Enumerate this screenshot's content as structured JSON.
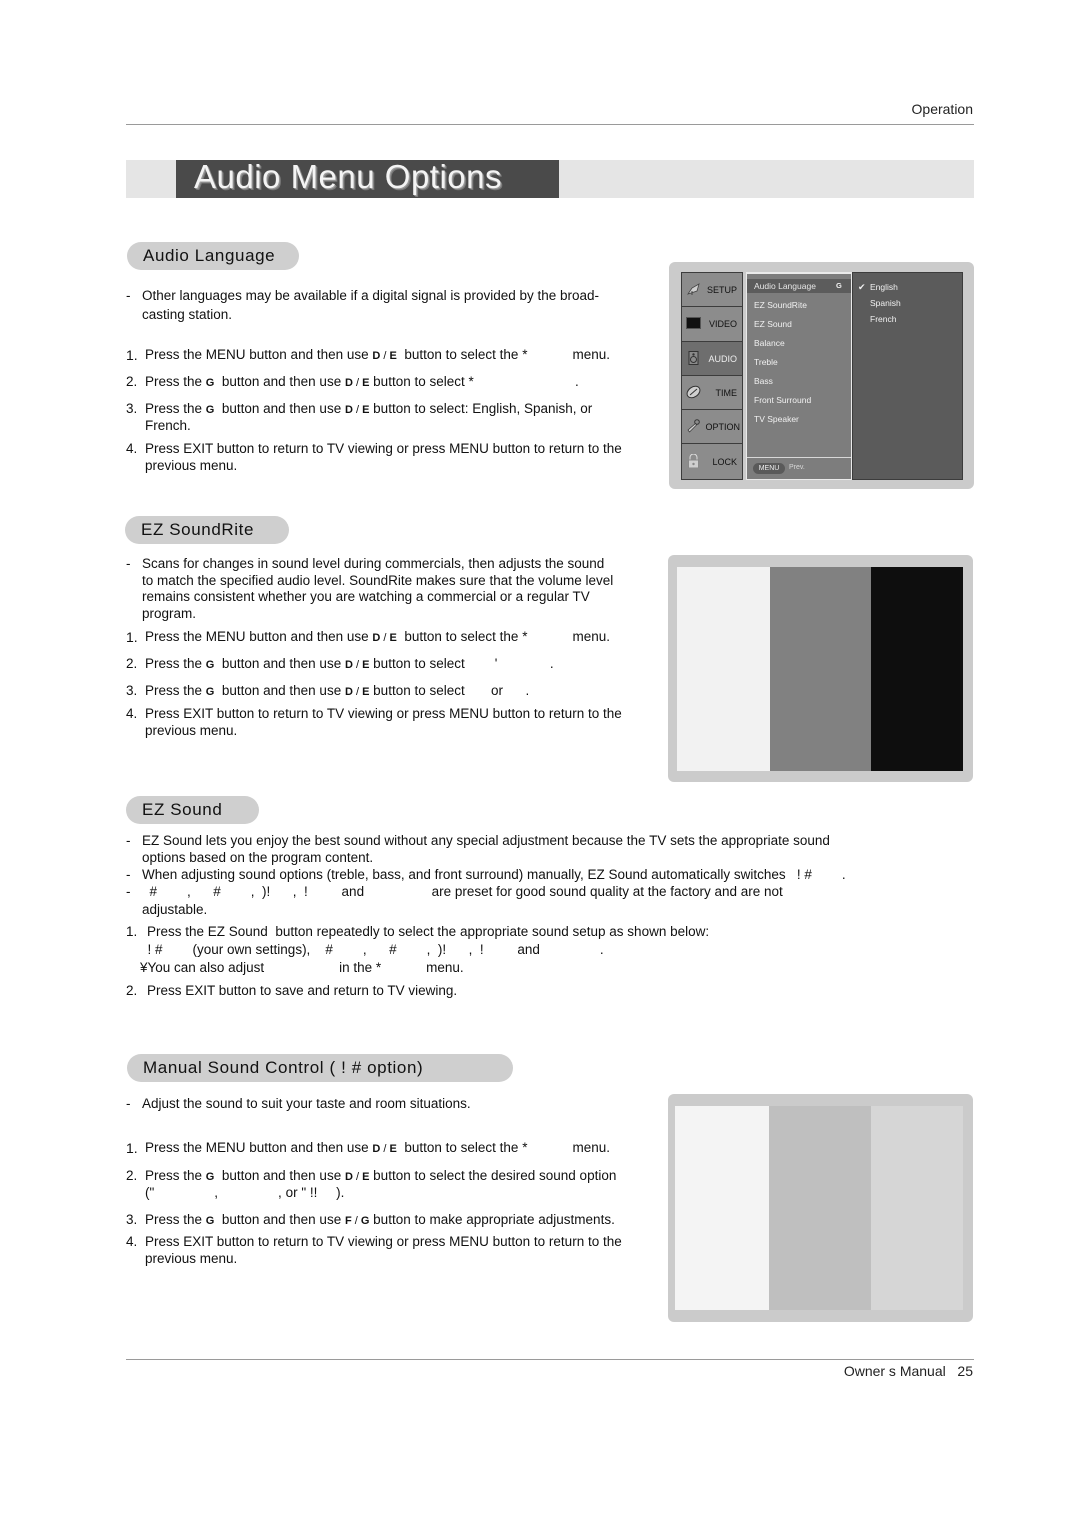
{
  "header": {
    "running_head": "Operation"
  },
  "title": "Audio Menu Options",
  "sections": {
    "audio_language": {
      "heading": "Audio Language",
      "notes": [
        "Other languages may be available if a digital signal is provided by the broad-",
        "casting station."
      ],
      "steps": [
        {
          "num": "1.",
          "parts": [
            "Press the MENU button and then use ",
            "D",
            " / ",
            "E",
            "  button to select the *            menu."
          ]
        },
        {
          "num": "2.",
          "parts": [
            "Press the ",
            "G",
            "  button and then use ",
            "D",
            " / ",
            "E",
            " button to select *                           ."
          ]
        },
        {
          "num": "3.",
          "line1": [
            "Press the ",
            "G",
            "  button and then use ",
            "D",
            " / ",
            "E",
            " button to select: English, Spanish, or"
          ],
          "line2": "French."
        },
        {
          "num": "4.",
          "line1": "Press EXIT button to return to TV viewing or press MENU button to return to the",
          "line2": "previous menu."
        }
      ]
    },
    "ez_soundrite": {
      "heading": "EZ SoundRite",
      "note_lines": [
        "Scans for changes in sound level during commercials, then adjusts the sound",
        "to match the specified audio level. SoundRite makes sure that the volume level",
        "remains consistent whether you are watching a commercial or a regular TV",
        "program."
      ],
      "steps": [
        {
          "num": "1.",
          "parts": [
            "Press the MENU button and then use ",
            "D",
            " / ",
            "E",
            "  button to select the *            menu."
          ]
        },
        {
          "num": "2.",
          "parts": [
            "Press the ",
            "G",
            "  button and then use ",
            "D",
            " / ",
            "E",
            " button to select        '              ."
          ]
        },
        {
          "num": "3.",
          "parts": [
            "Press the ",
            "G",
            "  button and then use ",
            "D",
            " / ",
            "E",
            " button to select       or      ."
          ]
        },
        {
          "num": "4.",
          "line1": "Press EXIT button to return to TV viewing or press MENU button to return to the",
          "line2": "previous menu."
        }
      ]
    },
    "ez_sound": {
      "heading": "EZ Sound",
      "notes": [
        {
          "line1": "EZ Sound lets you enjoy the best sound without any special adjustment because the TV sets the appropriate sound",
          "line2": "options based on the program content."
        },
        {
          "line1": "When adjusting sound options (treble, bass, and front surround) manually, EZ Sound automatically switches   ! #        ."
        },
        {
          "line1": "  #        ,      #        ,  )!      ,  !         and                  are preset for good sound quality at the factory and are not",
          "line2": "adjustable."
        }
      ],
      "steps": [
        {
          "num": "1.",
          "line1": "Press the EZ Sound  button repeatedly to select the appropriate sound setup as shown below:",
          "line2": "  ! #        (your own settings),    #        ,      #        ,  )!      ,  !         and                .",
          "line3": "¥You can also adjust                    in the *            menu."
        },
        {
          "num": "2.",
          "line1": "Press EXIT button to save and return to TV viewing."
        }
      ]
    },
    "manual_sound": {
      "heading": "Manual Sound Control (  ! #          option)",
      "notes": [
        "Adjust the sound to suit your taste and room situations."
      ],
      "steps": [
        {
          "num": "1.",
          "parts": [
            "Press the MENU button and then use ",
            "D",
            " / ",
            "E",
            "  button to select the *            menu."
          ]
        },
        {
          "num": "2.",
          "parts": [
            "Press the ",
            "G",
            "  button and then use ",
            "D",
            " / ",
            "E",
            " button to select the desired sound option"
          ],
          "line2": "(\"                ,                , or \" !!     )."
        },
        {
          "num": "3.",
          "parts": [
            "Press the ",
            "G",
            "  button and then use ",
            "F",
            " / ",
            "G",
            " button to make appropriate adjustments."
          ]
        },
        {
          "num": "4.",
          "line1": "Press EXIT button to return to TV viewing or press MENU button to return to the",
          "line2": "previous menu."
        }
      ]
    }
  },
  "tv_menu": {
    "tabs": [
      {
        "label": "SETUP",
        "icon": "satellite-dish-icon"
      },
      {
        "label": "VIDEO",
        "icon": "screen-icon"
      },
      {
        "label": "AUDIO",
        "icon": "speaker-icon",
        "active": true
      },
      {
        "label": "TIME",
        "icon": "clock-icon"
      },
      {
        "label": "OPTION",
        "icon": "wrench-icon"
      },
      {
        "label": "LOCK",
        "icon": "padlock-icon"
      }
    ],
    "items": [
      "Audio Language",
      "EZ SoundRite",
      "EZ Sound",
      "Balance",
      "Treble",
      "Bass",
      "Front Surround",
      "TV Speaker"
    ],
    "selected_item": "Audio Language",
    "selected_arrow": "G",
    "options": [
      "English",
      "Spanish",
      "French"
    ],
    "checked_option": "English",
    "check_mark": "✔",
    "footer_button": "MENU",
    "footer_label": "Prev."
  },
  "illustrations": {
    "soundrite_panel": {
      "colors": [
        "#f2f2f2",
        "#818181",
        "#0e0e0e"
      ]
    },
    "manual_panel": {
      "colors": [
        "#f4f4f4",
        "#bfbfbf",
        "#d6d6d6"
      ]
    }
  },
  "footer": {
    "label": "Owner s Manual",
    "page": "25"
  }
}
